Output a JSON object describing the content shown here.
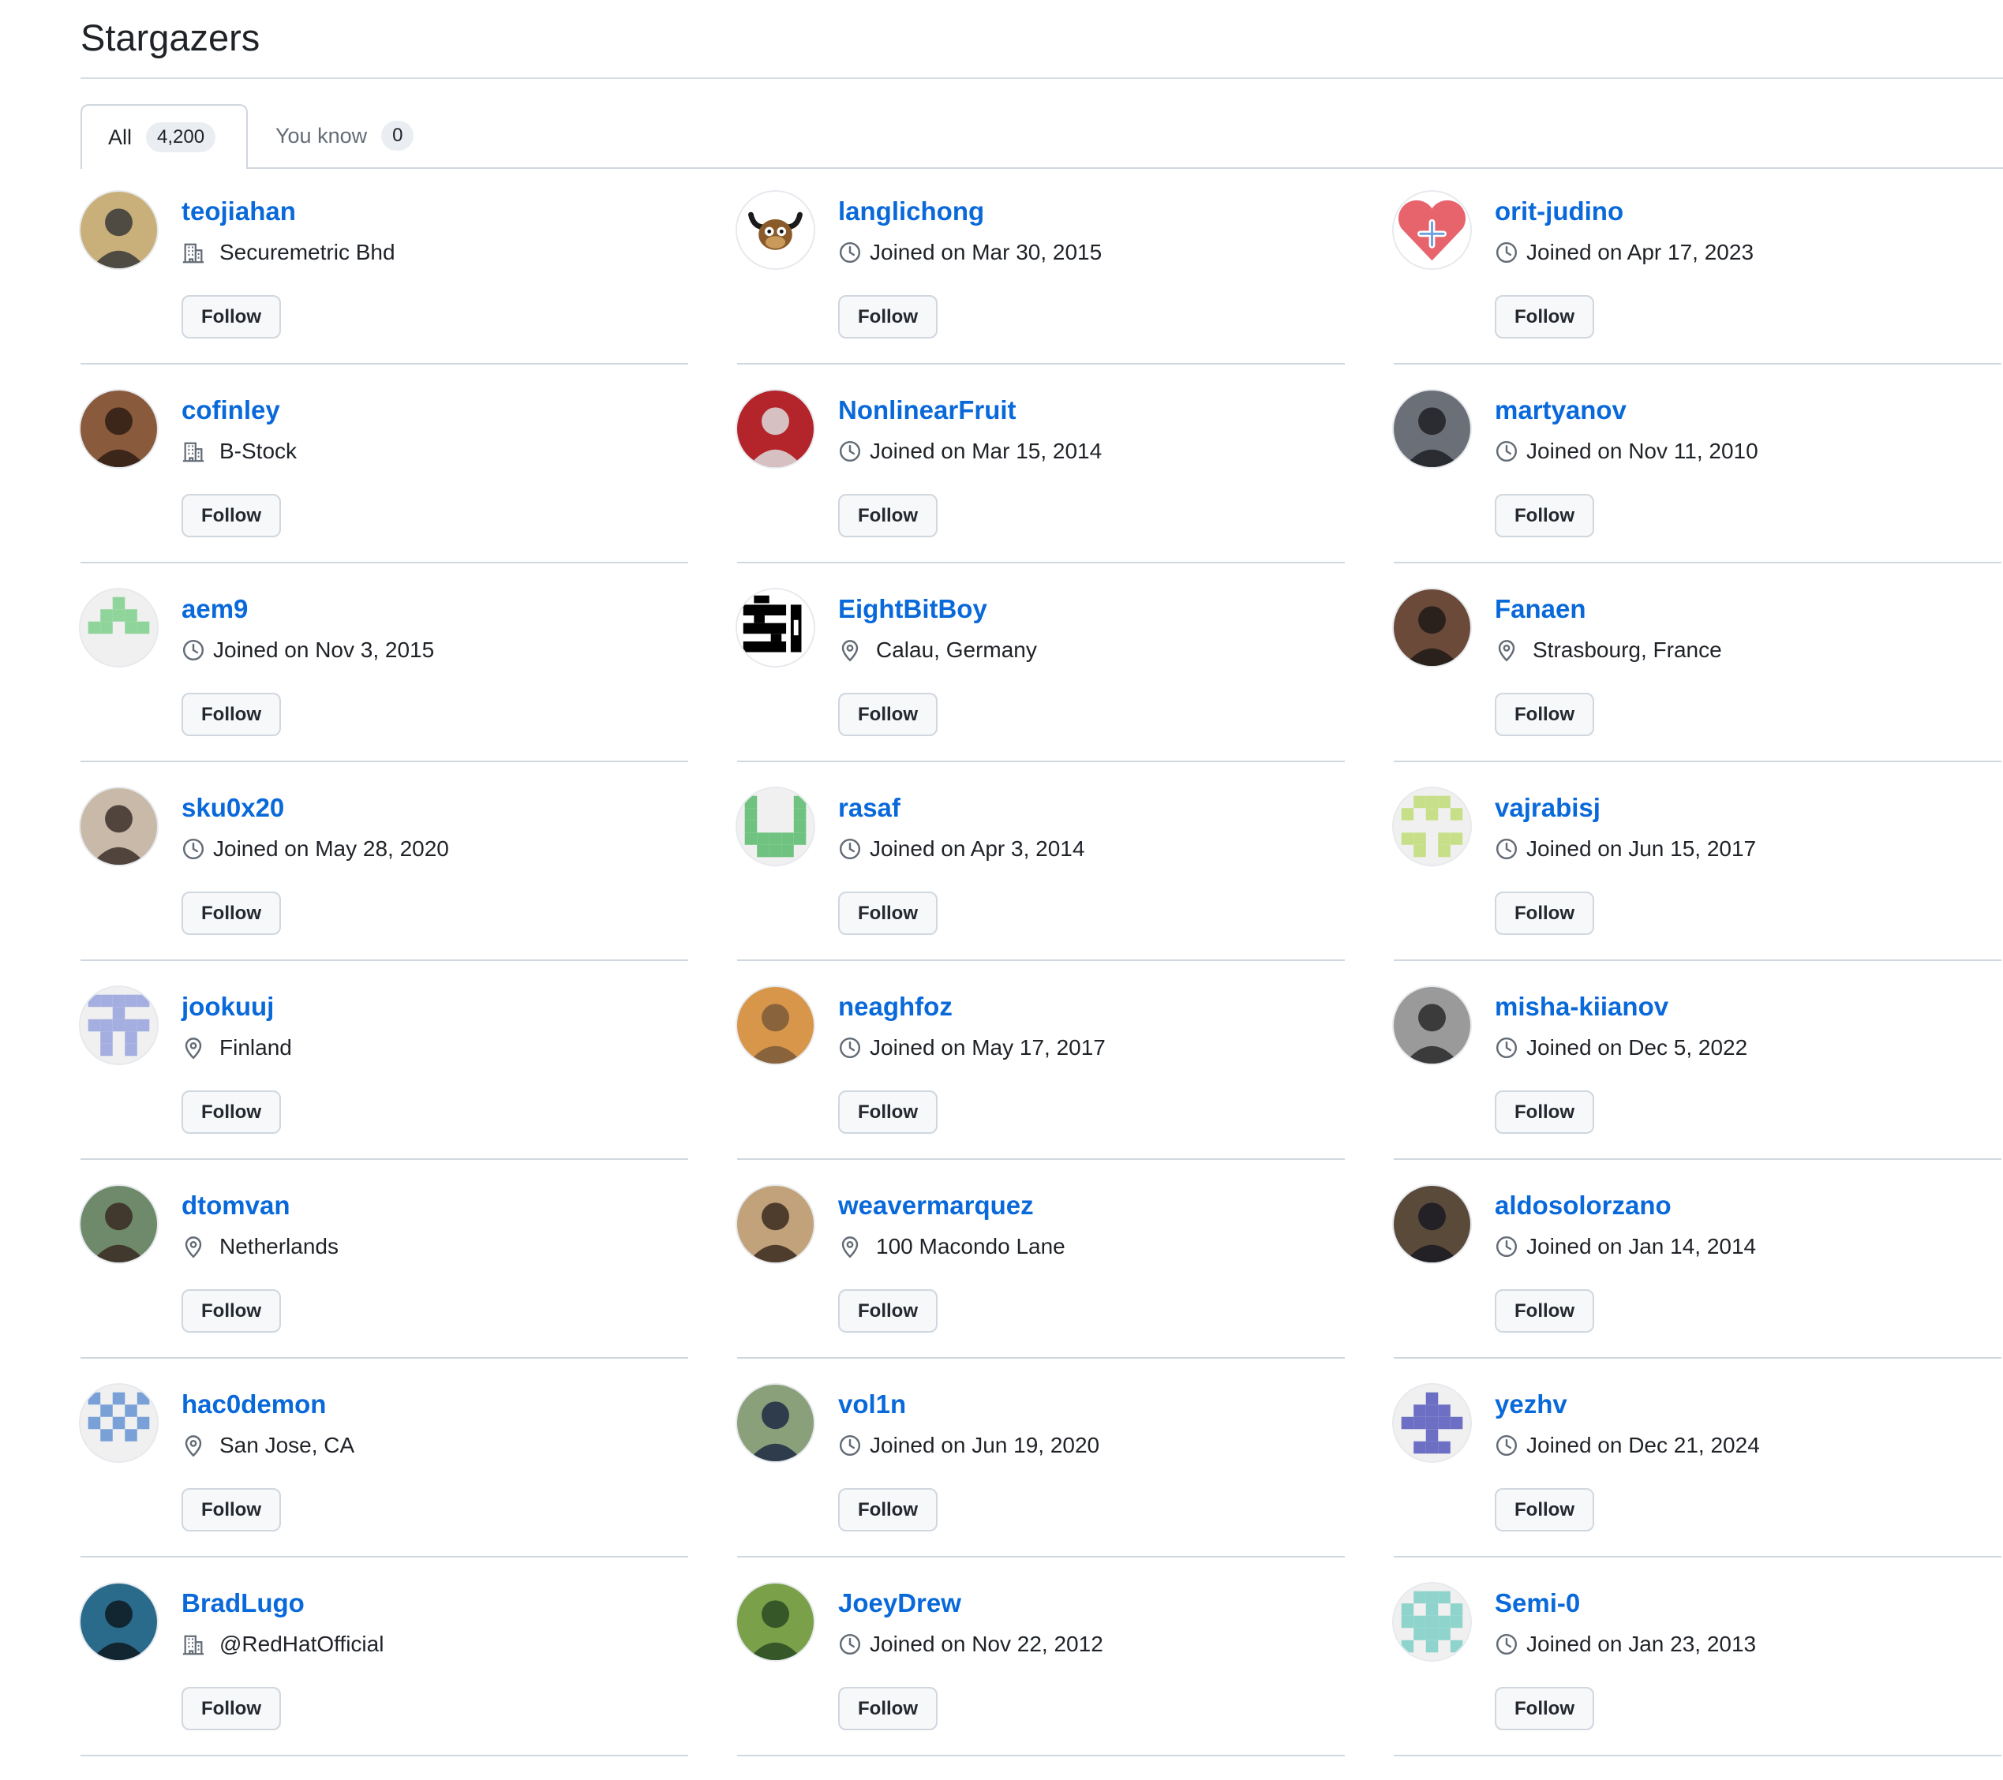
{
  "page": {
    "title": "Stargazers"
  },
  "tabs": [
    {
      "label": "All",
      "count": "4,200"
    },
    {
      "label": "You know",
      "count": "0"
    }
  ],
  "follow_label": "Follow",
  "users": [
    {
      "login": "teojiahan",
      "meta_type": "company",
      "meta": "Securemetric Bhd",
      "avatar": "photo",
      "colors": [
        "#c9b07a",
        "#3a3a3a"
      ]
    },
    {
      "login": "langlichong",
      "meta_type": "joined",
      "meta": "Joined on Mar 30, 2015",
      "avatar": "bull",
      "colors": [
        "#ffffff",
        "#5a3b1e"
      ]
    },
    {
      "login": "orit-judino",
      "meta_type": "joined",
      "meta": "Joined on Apr 17, 2023",
      "avatar": "heart",
      "colors": [
        "#ffffff",
        "#e8646c"
      ]
    },
    {
      "login": "cofinley",
      "meta_type": "company",
      "meta": "B-Stock",
      "avatar": "photo",
      "colors": [
        "#8a5a3c",
        "#2e1d14"
      ]
    },
    {
      "login": "NonlinearFruit",
      "meta_type": "joined",
      "meta": "Joined on Mar 15, 2014",
      "avatar": "photo",
      "colors": [
        "#b3242b",
        "#dcdcdc"
      ]
    },
    {
      "login": "martyanov",
      "meta_type": "joined",
      "meta": "Joined on Nov 11, 2010",
      "avatar": "photo",
      "colors": [
        "#6b6f78",
        "#1e2126"
      ]
    },
    {
      "login": "aem9",
      "meta_type": "joined",
      "meta": "Joined on Nov 3, 2015",
      "avatar": "identicon",
      "colors": [
        "#f0f0f0",
        "#8fd49a"
      ],
      "pattern": "00100 01110 11011 00000 00000"
    },
    {
      "login": "EightBitBoy",
      "meta_type": "location",
      "meta": "Calau, Germany",
      "avatar": "pixel",
      "colors": [
        "#ffffff",
        "#000000"
      ]
    },
    {
      "login": "Fanaen",
      "meta_type": "location",
      "meta": "Strasbourg, France",
      "avatar": "photo",
      "colors": [
        "#6b4a3a",
        "#1f1a18"
      ]
    },
    {
      "login": "sku0x20",
      "meta_type": "joined",
      "meta": "Joined on May 28, 2020",
      "avatar": "photo",
      "colors": [
        "#c9b9a9",
        "#3b2f2a"
      ]
    },
    {
      "login": "rasaf",
      "meta_type": "joined",
      "meta": "Joined on Apr 3, 2014",
      "avatar": "identicon",
      "colors": [
        "#f0f0f0",
        "#6fc27f"
      ],
      "pattern": "10001 10001 10001 11111 01110"
    },
    {
      "login": "vajrabisj",
      "meta_type": "joined",
      "meta": "Joined on Jun 15, 2017",
      "avatar": "identicon",
      "colors": [
        "#f0f0f0",
        "#c8df8a"
      ],
      "pattern": "01110 10101 00000 11011 01010"
    },
    {
      "login": "jookuuj",
      "meta_type": "location",
      "meta": "Finland",
      "avatar": "identicon",
      "colors": [
        "#f0f0f0",
        "#a4aee0"
      ],
      "pattern": "11111 00100 11111 01010 01010"
    },
    {
      "login": "neaghfoz",
      "meta_type": "joined",
      "meta": "Joined on May 17, 2017",
      "avatar": "photo",
      "colors": [
        "#d8964a",
        "#7a5a3a"
      ]
    },
    {
      "login": "misha-kiianov",
      "meta_type": "joined",
      "meta": "Joined on Dec 5, 2022",
      "avatar": "photo",
      "colors": [
        "#9a9a9a",
        "#2a2a2a"
      ]
    },
    {
      "login": "dtomvan",
      "meta_type": "location",
      "meta": "Netherlands",
      "avatar": "photo",
      "colors": [
        "#6f8a6a",
        "#3a2a22"
      ]
    },
    {
      "login": "weavermarquez",
      "meta_type": "location",
      "meta": "100 Macondo Lane",
      "avatar": "photo",
      "colors": [
        "#c2a27a",
        "#3a2a20"
      ]
    },
    {
      "login": "aldosolorzano",
      "meta_type": "joined",
      "meta": "Joined on Jan 14, 2014",
      "avatar": "photo",
      "colors": [
        "#5a4a3a",
        "#1a1a22"
      ]
    },
    {
      "login": "hac0demon",
      "meta_type": "location",
      "meta": "San Jose, CA",
      "avatar": "identicon",
      "colors": [
        "#f0f0f0",
        "#7aa0d8"
      ],
      "pattern": "10101 01010 10101 01010 00000"
    },
    {
      "login": "vol1n",
      "meta_type": "joined",
      "meta": "Joined on Jun 19, 2020",
      "avatar": "photo",
      "colors": [
        "#8aa07a",
        "#1e2a44"
      ]
    },
    {
      "login": "yezhv",
      "meta_type": "joined",
      "meta": "Joined on Dec 21, 2024",
      "avatar": "identicon",
      "colors": [
        "#f0f0f0",
        "#6c6fc4"
      ],
      "pattern": "00100 01110 11111 00100 01110"
    },
    {
      "login": "BradLugo",
      "meta_type": "company",
      "meta": "@RedHatOfficial",
      "avatar": "photo",
      "colors": [
        "#2a6a8a",
        "#0e1a22"
      ]
    },
    {
      "login": "JoeyDrew",
      "meta_type": "joined",
      "meta": "Joined on Nov 22, 2012",
      "avatar": "photo",
      "colors": [
        "#7aa04a",
        "#2a4a22"
      ]
    },
    {
      "login": "Semi-0",
      "meta_type": "joined",
      "meta": "Joined on Jan 23, 2013",
      "avatar": "identicon",
      "colors": [
        "#f0f0f0",
        "#8fd4cc"
      ],
      "pattern": "01110 10101 11111 01110 10101"
    }
  ]
}
